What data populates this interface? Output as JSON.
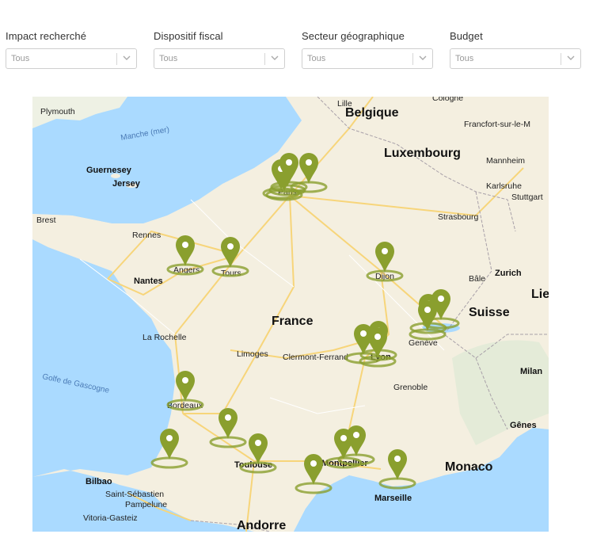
{
  "filters": [
    {
      "label": "Impact recherché",
      "value": "Tous"
    },
    {
      "label": "Dispositif fiscal",
      "value": "Tous"
    },
    {
      "label": "Secteur géographique",
      "value": "Tous"
    },
    {
      "label": "Budget",
      "value": "Tous"
    }
  ],
  "map": {
    "countries": [
      "Belgique",
      "Luxembourg",
      "France",
      "Suisse",
      "Monaco",
      "Andorre",
      "Lie"
    ],
    "islands": [
      "Guernesey",
      "Jersey"
    ],
    "seas": [
      "Manche (mer)",
      "Golfe de Gascogne"
    ],
    "cities": [
      "Plymouth",
      "Lille",
      "Cologne",
      "Francfort-sur-le-M",
      "Mannheim",
      "Karlsruhe",
      "Stuttgart",
      "Paris",
      "Brest",
      "Rennes",
      "Strasbourg",
      "Angers",
      "Tours",
      "Nantes",
      "Dijon",
      "Bâle",
      "Zurich",
      "Genève",
      "La Rochelle",
      "Limoges",
      "Clermont-Ferrand",
      "Lyon",
      "Milan",
      "Grenoble",
      "Bordeaux",
      "Gênes",
      "Toulouse",
      "Montpellier",
      "Marseille",
      "Bilbao",
      "Saint-Sébastien",
      "Pampelune",
      "Vitoria-Gasteiz"
    ],
    "marker_color": "#8a9f2e",
    "marker_count": 22
  }
}
